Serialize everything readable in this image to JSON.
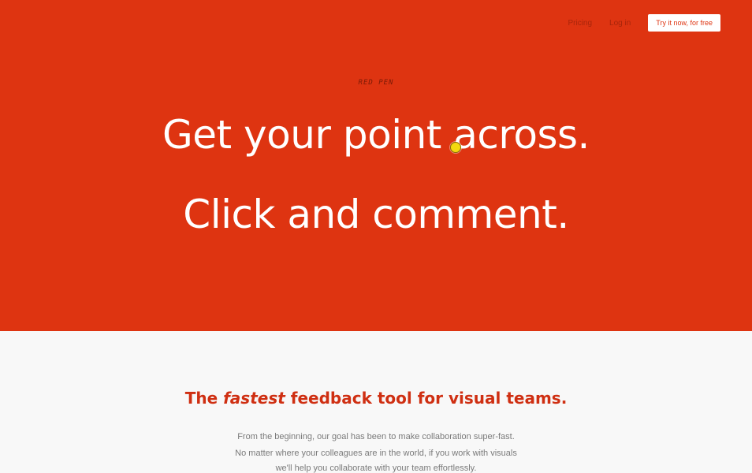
{
  "nav": {
    "pricing_label": "Pricing",
    "login_label": "Log in",
    "cta_label": "Try it now, for free"
  },
  "hero": {
    "brand": "RED PEN",
    "headline_1": "Get your point across.",
    "headline_2": "Click and comment.",
    "background_color": "#de3411",
    "cursor_marker_color": "#f3d90f"
  },
  "intro": {
    "tagline_prefix": "The ",
    "tagline_emphasis": "fastest",
    "tagline_suffix": " feedback tool for visual teams.",
    "paragraph_lines": [
      "From the beginning, our goal has been to make collaboration super-fast.",
      "No matter where your colleagues are in the world, if you work with visuals",
      "we'll help you collaborate with your team effortlessly."
    ]
  }
}
